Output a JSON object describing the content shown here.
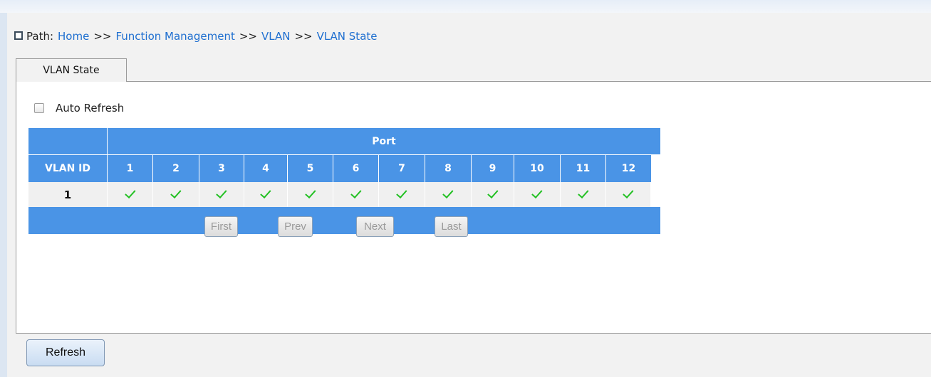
{
  "breadcrumb": {
    "prefix": "Path:",
    "items": [
      "Home",
      "Function Management",
      "VLAN",
      "VLAN State"
    ],
    "separator": ">>"
  },
  "tabs": [
    {
      "label": "VLAN State",
      "active": true
    }
  ],
  "auto_refresh": {
    "label": "Auto Refresh",
    "checked": false
  },
  "table": {
    "group_header": "Port",
    "id_header": "VLAN ID",
    "ports": [
      "1",
      "2",
      "3",
      "4",
      "5",
      "6",
      "7",
      "8",
      "9",
      "10",
      "11",
      "12"
    ],
    "rows": [
      {
        "vlan_id": "1",
        "member": [
          true,
          true,
          true,
          true,
          true,
          true,
          true,
          true,
          true,
          true,
          true,
          true
        ]
      }
    ]
  },
  "pager": {
    "first": "First",
    "prev": "Prev",
    "next": "Next",
    "last": "Last",
    "enabled": false
  },
  "refresh_button": "Refresh",
  "colors": {
    "header_bg": "#4a94e6",
    "check": "#22c022",
    "link": "#1f6fd0"
  }
}
